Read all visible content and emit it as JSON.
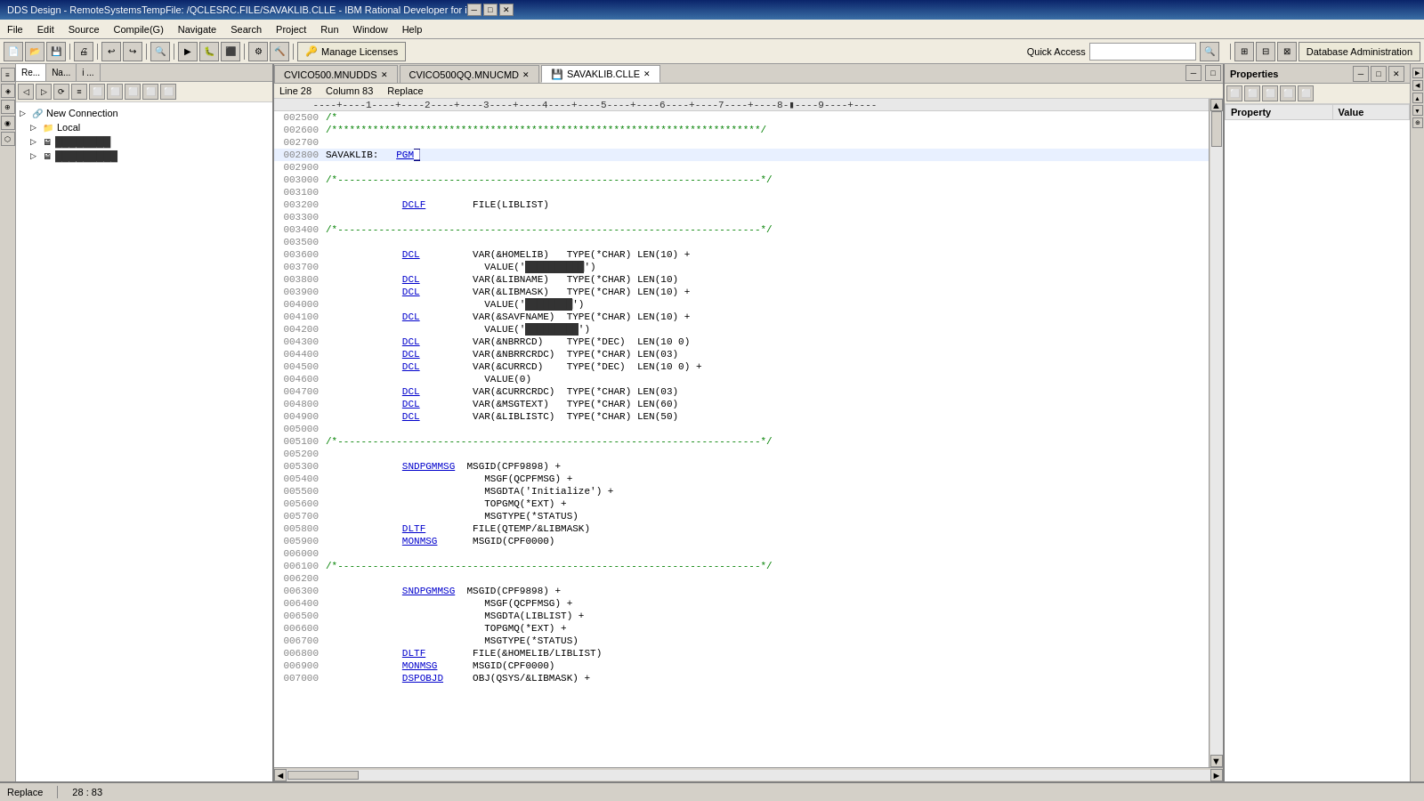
{
  "titlebar": {
    "title": "DDS Design - RemoteSystemsTempFile:                         /QCLESRC.FILE/SAVAKLIB.CLLE - IBM Rational Developer for i",
    "min": "─",
    "max": "□",
    "close": "✕"
  },
  "menubar": {
    "items": [
      "File",
      "Edit",
      "Source",
      "Compile(G)",
      "Navigate",
      "Search",
      "Project",
      "Run",
      "Window",
      "Help"
    ]
  },
  "toolbar": {
    "manage_licenses": "Manage Licenses",
    "db_admin": "Database Administration",
    "quick_access": "Quick Access"
  },
  "left_panel": {
    "tabs": [
      "Re...",
      "Na...",
      "i ..."
    ],
    "toolbar_buttons": [
      "◁",
      "▷",
      "⟳",
      "≡",
      "⬜",
      "⬜",
      "⬜",
      "⬜",
      "⬜"
    ],
    "tree": [
      {
        "label": "New Connection",
        "icon": "🔗",
        "indent": 0,
        "expand": "▷"
      },
      {
        "label": "Local",
        "icon": "📁",
        "indent": 1,
        "expand": "▷"
      },
      {
        "label": "████████",
        "icon": "🖥",
        "indent": 1,
        "expand": "▷"
      },
      {
        "label": "█████████",
        "icon": "🖥",
        "indent": 1,
        "expand": "▷"
      }
    ]
  },
  "editor": {
    "tabs": [
      {
        "label": "CVICO500.MNUDDS",
        "active": false
      },
      {
        "label": "CVICO500QQ.MNUCMD",
        "active": false
      },
      {
        "label": "SAVAKLIB.CLLE",
        "active": true,
        "icon": "💾"
      }
    ],
    "info": {
      "line_label": "Line 28",
      "column_label": "Column 83",
      "replace_label": "Replace"
    },
    "ruler": "----+----1----+----2----+----3----+----4----+----5----+----6----+----7----+----8-+----9----+----",
    "lines": [
      {
        "num": "002500",
        "content": "/*",
        "class": "comment"
      },
      {
        "num": "002600",
        "content": "/*************************************************************************/",
        "class": "comment"
      },
      {
        "num": "002700",
        "content": ""
      },
      {
        "num": "002800",
        "content": "SAVAKLIB:   PGM",
        "highlight": true
      },
      {
        "num": "002900",
        "content": ""
      },
      {
        "num": "003000",
        "content": "/*------------------------------------------------------------------------*/",
        "class": "comment"
      },
      {
        "num": "003100",
        "content": ""
      },
      {
        "num": "003200",
        "content": "             DCLF        FILE(LIBLIST)",
        "kw": "DCLF"
      },
      {
        "num": "003300",
        "content": ""
      },
      {
        "num": "003400",
        "content": "/*------------------------------------------------------------------------*/",
        "class": "comment"
      },
      {
        "num": "003500",
        "content": ""
      },
      {
        "num": "003600",
        "content": "             DCL         VAR(&HOMELIB)   TYPE(*CHAR) LEN(10) +",
        "kw": "DCL"
      },
      {
        "num": "003700",
        "content": "                           VALUE('██████████')",
        "str": true
      },
      {
        "num": "003800",
        "content": "             DCL         VAR(&LIBNAME)   TYPE(*CHAR) LEN(10)",
        "kw": "DCL"
      },
      {
        "num": "003900",
        "content": "             DCL         VAR(&LIBMASK)   TYPE(*CHAR) LEN(10) +",
        "kw": "DCL"
      },
      {
        "num": "004000",
        "content": "                           VALUE('████████')",
        "str": true
      },
      {
        "num": "004100",
        "content": "             DCL         VAR(&SAVFNAME)  TYPE(*CHAR) LEN(10) +",
        "kw": "DCL"
      },
      {
        "num": "004200",
        "content": "                           VALUE('█████████')",
        "str": true
      },
      {
        "num": "004300",
        "content": "             DCL         VAR(&NBRRCD)    TYPE(*DEC)  LEN(10 0)",
        "kw": "DCL"
      },
      {
        "num": "004400",
        "content": "             DCL         VAR(&NBRRCRDC)  TYPE(*CHAR) LEN(03)",
        "kw": "DCL"
      },
      {
        "num": "004500",
        "content": "             DCL         VAR(&CURRCD)    TYPE(*DEC)  LEN(10 0) +",
        "kw": "DCL"
      },
      {
        "num": "004600",
        "content": "                           VALUE(0)"
      },
      {
        "num": "004700",
        "content": "             DCL         VAR(&CURRCRDC)  TYPE(*CHAR) LEN(03)",
        "kw": "DCL"
      },
      {
        "num": "004800",
        "content": "             DCL         VAR(&MSGTEXT)   TYPE(*CHAR) LEN(60)",
        "kw": "DCL"
      },
      {
        "num": "004900",
        "content": "             DCL         VAR(&LIBLISTC)  TYPE(*CHAR) LEN(50)",
        "kw": "DCL"
      },
      {
        "num": "005000",
        "content": ""
      },
      {
        "num": "005100",
        "content": "/*------------------------------------------------------------------------*/",
        "class": "comment"
      },
      {
        "num": "005200",
        "content": ""
      },
      {
        "num": "005300",
        "content": "             SNDPGMMSG  MSGID(CPF9898) +",
        "kw": "SNDPGMMSG"
      },
      {
        "num": "005400",
        "content": "                           MSGF(QCPFMSG) +"
      },
      {
        "num": "005500",
        "content": "                           MSGDTA('Initialize') +"
      },
      {
        "num": "005600",
        "content": "                           TOPGMQ(*EXT) +"
      },
      {
        "num": "005700",
        "content": "                           MSGTYPE(*STATUS)"
      },
      {
        "num": "005800",
        "content": "             DLTF        FILE(QTEMP/&LIBMASK)",
        "kw": "DLTF"
      },
      {
        "num": "005900",
        "content": "             MONMSG      MSGID(CPF0000)",
        "kw": "MONMSG"
      },
      {
        "num": "006000",
        "content": ""
      },
      {
        "num": "006100",
        "content": "/*------------------------------------------------------------------------*/",
        "class": "comment"
      },
      {
        "num": "006200",
        "content": ""
      },
      {
        "num": "006300",
        "content": "             SNDPGMMSG  MSGID(CPF9898) +",
        "kw": "SNDPGMMSG"
      },
      {
        "num": "006400",
        "content": "                           MSGF(QCPFMSG) +"
      },
      {
        "num": "006500",
        "content": "                           MSGDTA(LIBLIST) +"
      },
      {
        "num": "006600",
        "content": "                           TOPGMQ(*EXT) +"
      },
      {
        "num": "006700",
        "content": "                           MSGTYPE(*STATUS)"
      },
      {
        "num": "006800",
        "content": "             DLTF        FILE(&HOMELIB/LIBLIST)",
        "kw": "DLTF"
      },
      {
        "num": "006900",
        "content": "             MONMSG      MSGID(CPF0000)",
        "kw": "MONMSG"
      },
      {
        "num": "007000",
        "content": "             DSPOBJD     OBJ(QSYS/&LIBMASK) +",
        "kw": "DSPOBJD"
      }
    ]
  },
  "properties": {
    "title": "Properties",
    "columns": [
      "Property",
      "Value"
    ],
    "rows": []
  },
  "statusbar": {
    "replace": "Replace",
    "position": "28 : 83"
  }
}
